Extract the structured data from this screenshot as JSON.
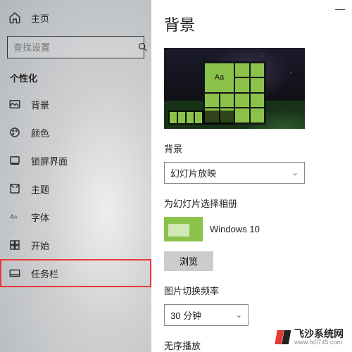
{
  "titlebar": {
    "minimize": "—",
    "close": "✕"
  },
  "sidebar": {
    "home": {
      "label": "主页"
    },
    "search": {
      "placeholder": "查找设置"
    },
    "section": "个性化",
    "items": [
      {
        "id": "background",
        "label": "背景"
      },
      {
        "id": "colors",
        "label": "颜色"
      },
      {
        "id": "lockscreen",
        "label": "锁屏界面"
      },
      {
        "id": "themes",
        "label": "主题"
      },
      {
        "id": "fonts",
        "label": "字体"
      },
      {
        "id": "start",
        "label": "开始"
      },
      {
        "id": "taskbar",
        "label": "任务栏"
      }
    ]
  },
  "main": {
    "title": "背景",
    "preview_tile_text": "Aa",
    "bg_label": "背景",
    "bg_select": "幻灯片放映",
    "album_label": "为幻灯片选择相册",
    "album_name": "Windows 10",
    "browse": "浏览",
    "interval_label": "图片切换频率",
    "interval_value": "30 分钟",
    "shuffle_label": "无序播放"
  },
  "watermark": {
    "line1": "飞沙系统网",
    "line2": "www.fs0745.com"
  }
}
